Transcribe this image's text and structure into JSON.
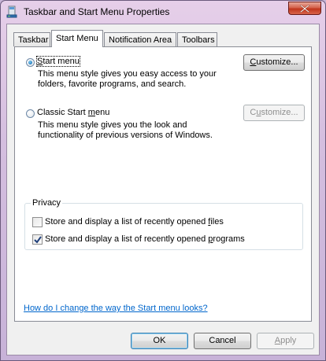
{
  "window": {
    "title": "Taskbar and Start Menu Properties"
  },
  "tabs": [
    {
      "label": "Taskbar"
    },
    {
      "label": "Start Menu"
    },
    {
      "label": "Notification Area"
    },
    {
      "label": "Toolbars"
    }
  ],
  "start_menu_option": {
    "label_pre": "",
    "label_key": "S",
    "label_post": "tart menu",
    "selected": true,
    "description_line1": "This menu style gives you easy access to your",
    "description_line2": "folders, favorite programs, and search.",
    "customize_pre": "",
    "customize_key": "C",
    "customize_post": "ustomize..."
  },
  "classic_option": {
    "label_pre": "Classic Start ",
    "label_key": "m",
    "label_post": "enu",
    "selected": false,
    "description_line1": "This menu style gives you the look and",
    "description_line2": "functionality of previous versions of Windows.",
    "customize_pre": "C",
    "customize_key": "u",
    "customize_post": "stomize..."
  },
  "privacy": {
    "title": "Privacy",
    "files_pre": "Store and display a list of recently opened ",
    "files_key": "f",
    "files_post": "iles",
    "files_checked": false,
    "programs_pre": "Store and display a list of recently opened ",
    "programs_key": "p",
    "programs_post": "rograms",
    "programs_checked": true
  },
  "help_link": "How do I change the way the Start menu looks?",
  "buttons": {
    "ok": "OK",
    "cancel": "Cancel",
    "apply_key": "A",
    "apply_post": "pply"
  }
}
